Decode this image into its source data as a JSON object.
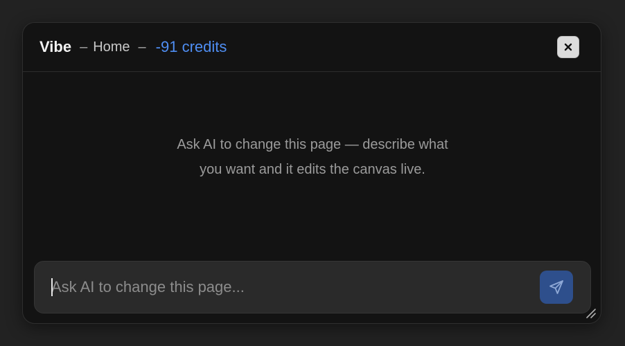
{
  "header": {
    "app_name": "Vibe",
    "separator_1": "–",
    "breadcrumb": "Home",
    "separator_2": "–",
    "credits": "-91 credits"
  },
  "close_button": {
    "icon": "close-icon"
  },
  "main": {
    "hint": "Ask AI to change this page — describe what you want and it edits the canvas live."
  },
  "prompt": {
    "placeholder": "Ask AI to change this page...",
    "value": ""
  },
  "send_button": {
    "icon": "send-icon"
  },
  "colors": {
    "background": "#222222",
    "panel": "#131313",
    "accent": "#4f8ef3",
    "send_button": "#2e4f8c"
  }
}
